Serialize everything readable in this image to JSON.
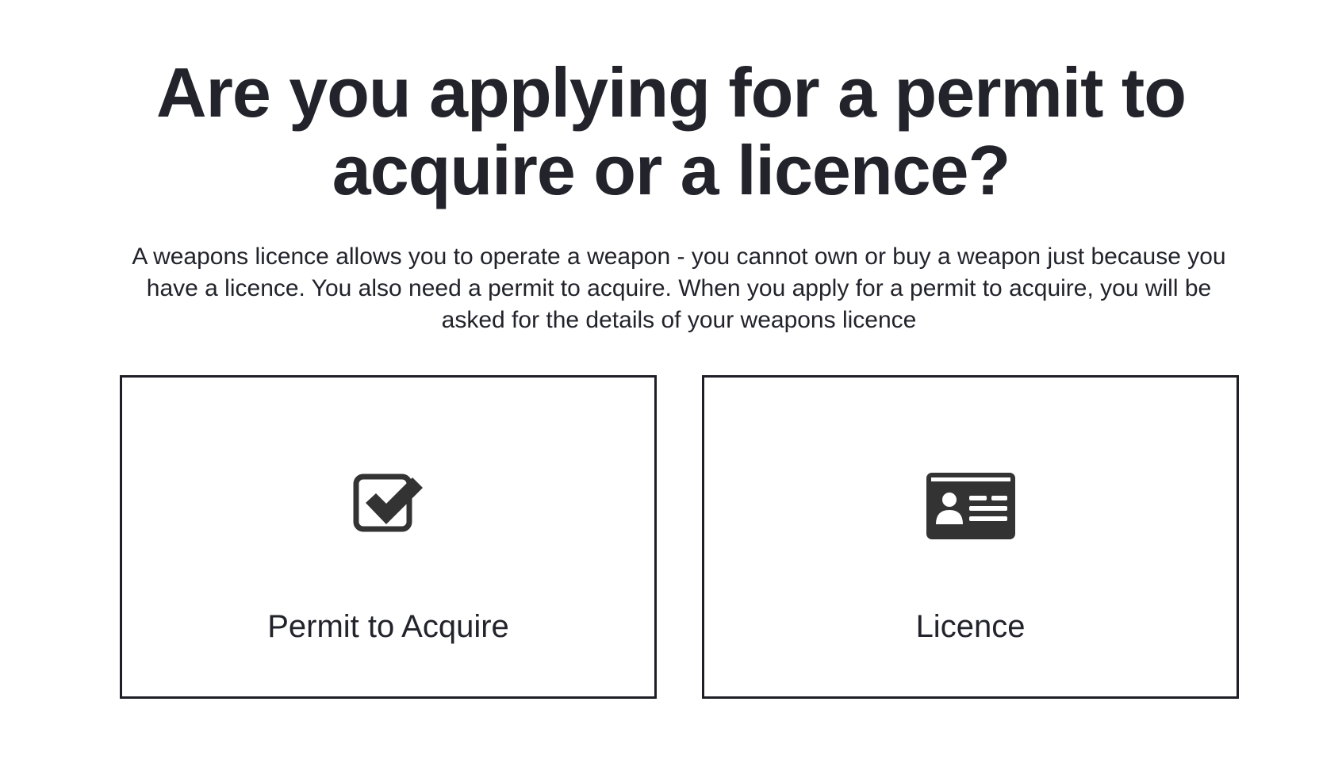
{
  "header": {
    "title": "Are you applying for a permit to acquire or a licence?",
    "description": "A weapons licence allows you to operate a weapon - you cannot own or buy a weapon just because you have a licence. You also need a permit to acquire. When you apply for a permit to acquire, you will be asked for the details of your weapons licence"
  },
  "options": [
    {
      "label": "Permit to Acquire",
      "icon": "checkbox-checked-icon"
    },
    {
      "label": "Licence",
      "icon": "id-card-icon"
    }
  ],
  "colors": {
    "text": "#22232b",
    "border": "#1e1f26",
    "icon": "#333333",
    "background": "#ffffff"
  }
}
